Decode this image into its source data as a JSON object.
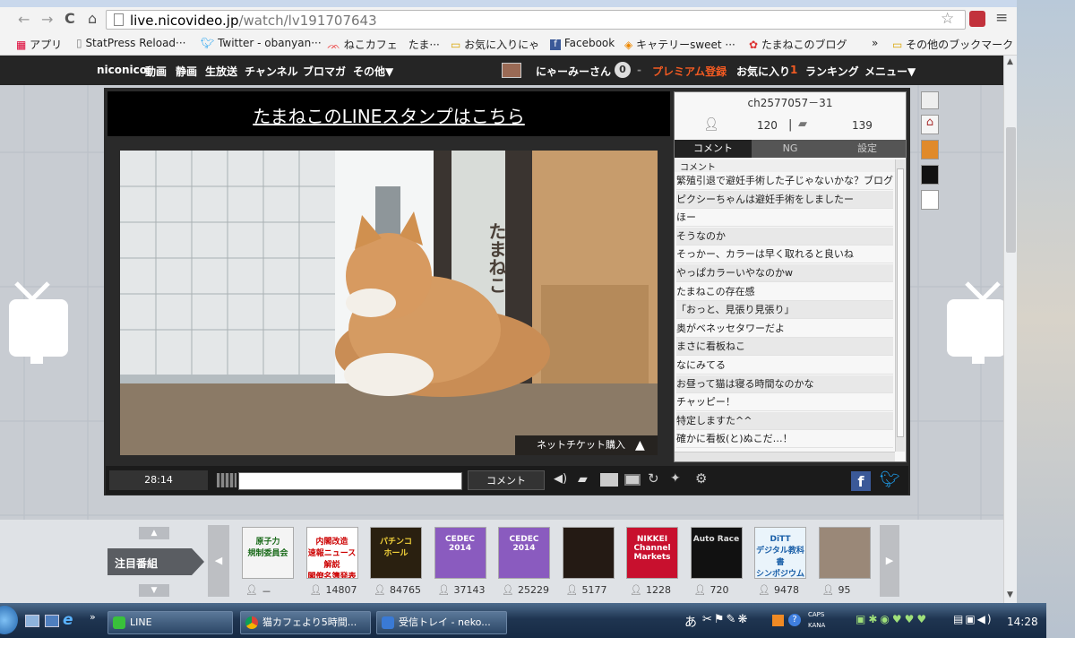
{
  "browser": {
    "url_host": "live.nicovideo.jp",
    "url_path": "/watch/lv191707643",
    "bookmarks": [
      "アプリ",
      "StatPress Reload···",
      "Twitter - obanyan···",
      "ねこカフェ　たま···",
      "お気に入りにゃ",
      "Facebook",
      "キャテリーsweet ···",
      "たまねこのブログ",
      "»",
      "その他のブックマーク"
    ]
  },
  "nicobar": {
    "links": [
      "niconico",
      "動画",
      "静画",
      "生放送",
      "チャンネル",
      "ブロマガ",
      "その他▼"
    ],
    "user": "にゃーみーさん",
    "points": "0",
    "premium": "プレミアム登録",
    "favorites": "お気に入り",
    "fav_count": "1",
    "ranking": "ランキング",
    "menu": "メニュー▼"
  },
  "player": {
    "banner": "たまねこのLINEスタンプはこちら",
    "ticket": "ネットチケット購入",
    "time": "28:14",
    "comment_button": "コメント",
    "signage": "たまねこ"
  },
  "panel": {
    "channel": "ch2577057－31",
    "viewers": "120",
    "comments": "139",
    "tabs": [
      "コメント",
      "NG",
      "設定"
    ],
    "header": "コメント",
    "rows": [
      "繁殖引退で避妊手術した子じゃないかな？ブログで",
      "ピクシーちゃんは避妊手術をしましたー",
      "ほー",
      "そうなのか",
      "そっかー、カラーは早く取れると良いね",
      "やっぱカラーいやなのかw",
      "たまねこの存在感",
      "「おっと、見張り見張り」",
      "奥がベネッセタワーだよ",
      "まさに看板ねこ",
      "なにみてる",
      "お昼って猫は寝る時間なのかな",
      "チャッピー！",
      "特定しますた^^",
      "確かに看板(と)ぬこだ…！"
    ]
  },
  "bottom": {
    "label": "注目番組",
    "thumbs": [
      {
        "text": "原子力\n規制委員会",
        "count": "－"
      },
      {
        "text": "内閣改造\n速報ニュース解説\n閣僚名簿発表",
        "count": "14807"
      },
      {
        "text": "パチンコ\nホール",
        "count": "84765"
      },
      {
        "text": "CEDEC\n2014",
        "count": "37143"
      },
      {
        "text": "CEDEC\n2014",
        "count": "25229"
      },
      {
        "text": "",
        "count": "5177"
      },
      {
        "text": "NIKKEI\nChannel\nMarkets",
        "count": "1228"
      },
      {
        "text": "Auto Race",
        "count": "720"
      },
      {
        "text": "DiTT\nデジタル教科書\nシンポジウム",
        "count": "9478"
      },
      {
        "text": "",
        "count": "95"
      }
    ]
  },
  "taskbar": {
    "buttons": [
      "LINE",
      "猫カフェより5時間...",
      "受信トレイ - neko..."
    ],
    "tray_text": "あ",
    "caps": "CAPS",
    "kana": "KANA",
    "clock": "14:28"
  },
  "colors": {
    "accent": "#f15a22",
    "fb": "#3b5998",
    "twitter": "#1da1f2",
    "taskbar": "#1f3551"
  }
}
